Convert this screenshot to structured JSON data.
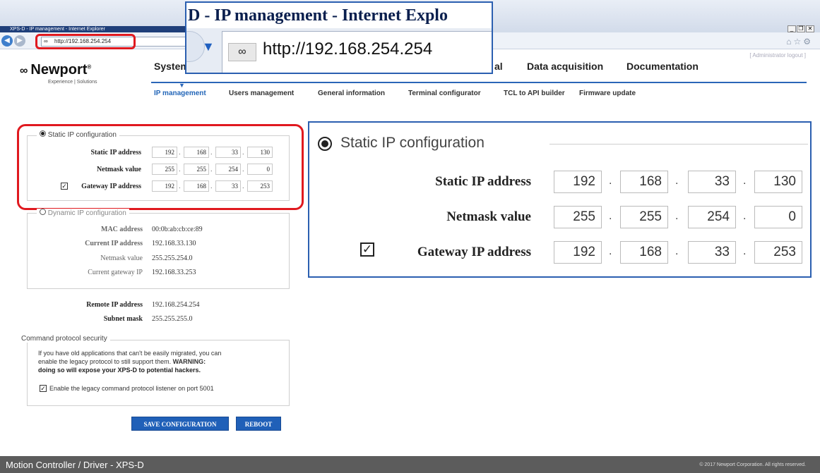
{
  "browser": {
    "window_title": "XPS-D - IP management - Internet Explorer",
    "url": "http://192.168.254.254",
    "admin_logout": "[ Administrator logout ]",
    "zoom_title": "D - IP management - Internet Explo",
    "zoom_url": "http://192.168.254.254"
  },
  "header": {
    "logo": "Newport",
    "tagline": "Experience | Solutions",
    "top_nav": [
      "System",
      "al",
      "Data acquisition",
      "Documentation"
    ],
    "sub_nav": [
      "IP management",
      "Users management",
      "General information",
      "Terminal configurator",
      "TCL to API builder",
      "Firmware update"
    ]
  },
  "static_ip": {
    "legend": "Static IP configuration",
    "rows": [
      {
        "label": "Static IP address",
        "octets": [
          "192",
          "168",
          "33",
          "130"
        ]
      },
      {
        "label": "Netmask value",
        "octets": [
          "255",
          "255",
          "254",
          "0"
        ]
      },
      {
        "label": "Gateway IP address",
        "octets": [
          "192",
          "168",
          "33",
          "253"
        ]
      }
    ]
  },
  "dynamic_ip": {
    "legend": "Dynamic IP configuration",
    "rows": [
      {
        "label": "MAC address",
        "value": "00:0b:ab:cb:ce:89"
      },
      {
        "label": "Current IP address",
        "value": "192.168.33.130"
      },
      {
        "label": "Netmask value",
        "value": "255.255.254.0"
      },
      {
        "label": "Current gateway IP",
        "value": "192.168.33.253"
      }
    ]
  },
  "remote": {
    "rows": [
      {
        "label": "Remote IP address",
        "value": "192.168.254.254"
      },
      {
        "label": "Subnet mask",
        "value": "255.255.255.0"
      }
    ]
  },
  "security": {
    "legend": "Command protocol security",
    "line1": "If you have old applications that can't be easily migrated, you can",
    "line2a": "enable the legacy protocol to still support them.",
    "warning": "WARNING:",
    "line3": "doing so will expose your XPS-D to potential hackers.",
    "checkbox_label": "Enable the legacy command protocol listener on port 5001"
  },
  "buttons": {
    "save": "SAVE CONFIGURATION",
    "reboot": "REBOOT"
  },
  "footer": {
    "left": "Motion Controller / Driver - XPS-D",
    "right": "© 2017 Newport Corporation. All rights reserved."
  },
  "colors": {
    "accent": "#2060b8",
    "highlight": "#e0191f",
    "footer": "#5c5c5c"
  }
}
